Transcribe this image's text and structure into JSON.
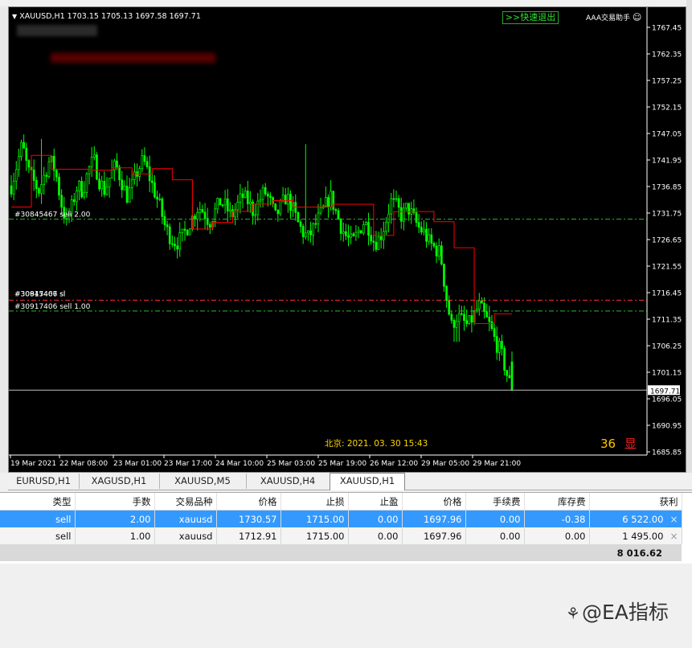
{
  "chart": {
    "symbol_header": "XAUUSD,H1  1703.15 1705.13 1697.58 1697.71",
    "quick_exit_button": ">>快速退出",
    "assistant_label": "AAA交易助手",
    "beijing_time": "北京: 2021. 03. 30  15:43",
    "counter": "36",
    "counter_suffix": "显",
    "current_price_label": "1697.71",
    "price_axis_labels": [
      "1767.45",
      "1762.35",
      "1757.25",
      "1752.15",
      "1747.05",
      "1741.95",
      "1736.85",
      "1731.75",
      "1726.65",
      "1721.55",
      "1716.45",
      "1711.35",
      "1706.25",
      "1701.15",
      "1696.05",
      "1690.95",
      "1685.85"
    ],
    "time_axis_labels": [
      "19 Mar 2021",
      "22 Mar 08:00",
      "23 Mar 01:00",
      "23 Mar 17:00",
      "24 Mar 10:00",
      "25 Mar 03:00",
      "25 Mar 19:00",
      "26 Mar 12:00",
      "29 Mar 05:00",
      "29 Mar 21:00"
    ],
    "order_labels": [
      "#30845467 sell 2.00",
      "#30845467 sl",
      "#30917406 sl",
      "#30917406 sell 1.00"
    ],
    "colors": {
      "bull": "#00ff00",
      "bear": "#00ff00",
      "trail": "#ff0000",
      "open_line": "#2eb82e",
      "sl_line": "#ff3030",
      "bid_line": "#c0c0c0"
    }
  },
  "chart_data": {
    "type": "candlestick",
    "symbol": "XAUUSD",
    "timeframe": "H1",
    "last_bar": {
      "open": 1703.15,
      "high": 1705.13,
      "low": 1697.58,
      "close": 1697.71
    },
    "ylim": [
      1685.85,
      1767.45
    ],
    "current_price": 1697.71,
    "levels": [
      {
        "label": "#30845467 sell 2.00",
        "price": 1730.57
      },
      {
        "label": "#30917406 sell 1.00",
        "price": 1712.91
      },
      {
        "label": "#30845467 sl",
        "price": 1715.0
      },
      {
        "label": "#30917406 sl",
        "price": 1715.0
      }
    ],
    "path_close": [
      1737,
      1741,
      1745,
      1740,
      1738,
      1736,
      1739,
      1742,
      1740,
      1734,
      1730,
      1733,
      1737,
      1736,
      1740,
      1742,
      1738,
      1736,
      1739,
      1741,
      1738,
      1735,
      1737,
      1740,
      1742,
      1739,
      1736,
      1733,
      1729,
      1727,
      1726,
      1727,
      1729,
      1731,
      1733,
      1732,
      1730,
      1732,
      1734,
      1733,
      1731,
      1733,
      1735,
      1734,
      1732,
      1734,
      1736,
      1734,
      1731,
      1733,
      1735,
      1733,
      1730,
      1728,
      1727,
      1729,
      1731,
      1733,
      1735,
      1732,
      1729,
      1727,
      1726,
      1728,
      1730,
      1729,
      1726,
      1727,
      1730,
      1734,
      1733,
      1731,
      1733,
      1731,
      1729,
      1728,
      1726,
      1725,
      1724,
      1716,
      1710,
      1712,
      1711,
      1710,
      1712,
      1714,
      1712,
      1710,
      1707,
      1705,
      1701,
      1697.7
    ]
  },
  "tabs": [
    "EURUSD,H1",
    "XAGUSD,H1",
    "XAUUSD,M5",
    "XAUUSD,H4",
    "XAUUSD,H1"
  ],
  "table": {
    "headers": [
      "类型",
      "手数",
      "交易品种",
      "价格",
      "止损",
      "止盈",
      "价格",
      "手续费",
      "库存费",
      "获利"
    ],
    "rows": [
      [
        "sell",
        "2.00",
        "xauusd",
        "1730.57",
        "1715.00",
        "0.00",
        "1697.96",
        "0.00",
        "-0.38",
        "6 522.00"
      ],
      [
        "sell",
        "1.00",
        "xauusd",
        "1712.91",
        "1715.00",
        "0.00",
        "1697.96",
        "0.00",
        "0.00",
        "1 495.00"
      ]
    ],
    "total": "8 016.62",
    "close_symbol": "×"
  },
  "watermark": "@EA指标"
}
